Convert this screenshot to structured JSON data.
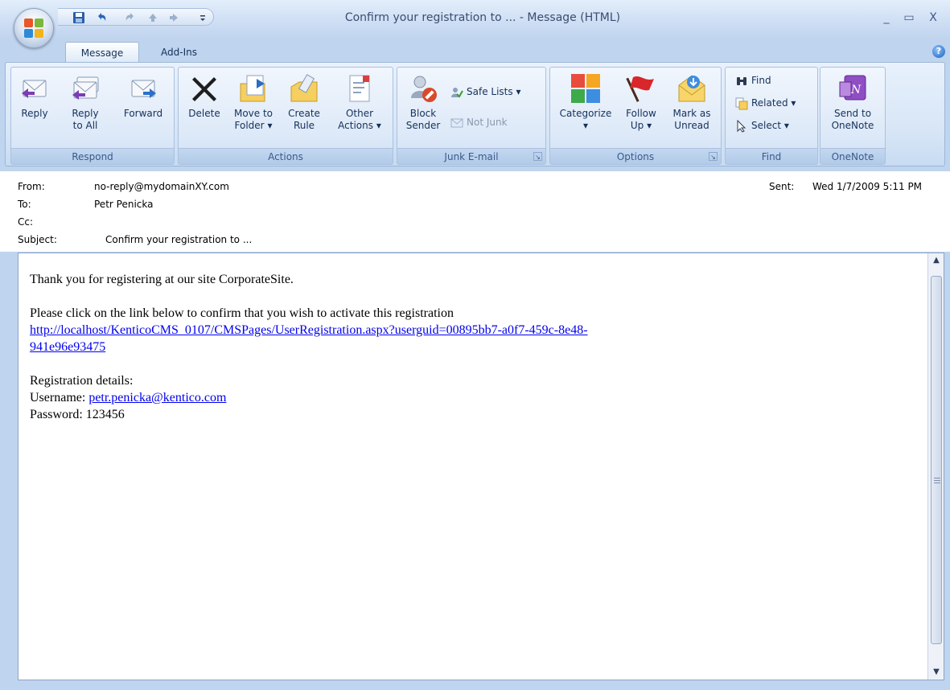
{
  "window": {
    "title": "Confirm your registration to ... - Message (HTML)",
    "minimize": "_",
    "maximize": "▭",
    "close": "X"
  },
  "quick_access": {
    "save": "save-icon",
    "undo": "undo-icon",
    "redo": "redo-icon",
    "previous": "up-arrow-icon",
    "next": "down-arrow-icon",
    "customize": "customize-icon"
  },
  "tabs": [
    {
      "label": "Message"
    },
    {
      "label": "Add-Ins"
    }
  ],
  "help_label": "?",
  "ribbon": {
    "respond": {
      "label": "Respond",
      "reply": "Reply",
      "reply_all_1": "Reply",
      "reply_all_2": "to All",
      "forward": "Forward"
    },
    "actions": {
      "label": "Actions",
      "delete": "Delete",
      "move_1": "Move to",
      "move_2": "Folder",
      "create_1": "Create",
      "create_2": "Rule",
      "other_1": "Other",
      "other_2": "Actions"
    },
    "junk": {
      "label": "Junk E-mail",
      "block_1": "Block",
      "block_2": "Sender",
      "safe_lists": "Safe Lists",
      "not_junk": "Not Junk"
    },
    "options": {
      "label": "Options",
      "categorize": "Categorize",
      "follow_1": "Follow",
      "follow_2": "Up",
      "mark_1": "Mark as",
      "mark_2": "Unread"
    },
    "find": {
      "label": "Find",
      "find": "Find",
      "related": "Related",
      "select": "Select"
    },
    "onenote": {
      "label": "OneNote",
      "send_1": "Send to",
      "send_2": "OneNote"
    }
  },
  "header": {
    "from_label": "From:",
    "from_value": "no-reply@mydomainXY.com",
    "to_label": "To:",
    "to_value": "Petr Penicka",
    "cc_label": "Cc:",
    "cc_value": "",
    "subject_label": "Subject:",
    "subject_value": "Confirm your registration to ...",
    "sent_label": "Sent:",
    "sent_value": "Wed 1/7/2009 5:11 PM"
  },
  "body": {
    "line1": "Thank you for registering at our site CorporateSite.",
    "line2": "Please click on the link below to confirm that you wish to activate this registration",
    "link_part1": "http://localhost/KenticoCMS_0107/CMSPages/UserRegistration.aspx?userguid=00895bb7-a0f7-459c-8e48-",
    "link_part2": "941e96e93475",
    "details_heading": "Registration details:",
    "username_label": "Username: ",
    "username_value": "petr.penicka@kentico.com",
    "password_label": "Password: ",
    "password_value": "123456"
  },
  "colors": {
    "ribbon_bg": "#d6e5f6",
    "link": "#0000ee",
    "flag_red": "#d9262b"
  }
}
